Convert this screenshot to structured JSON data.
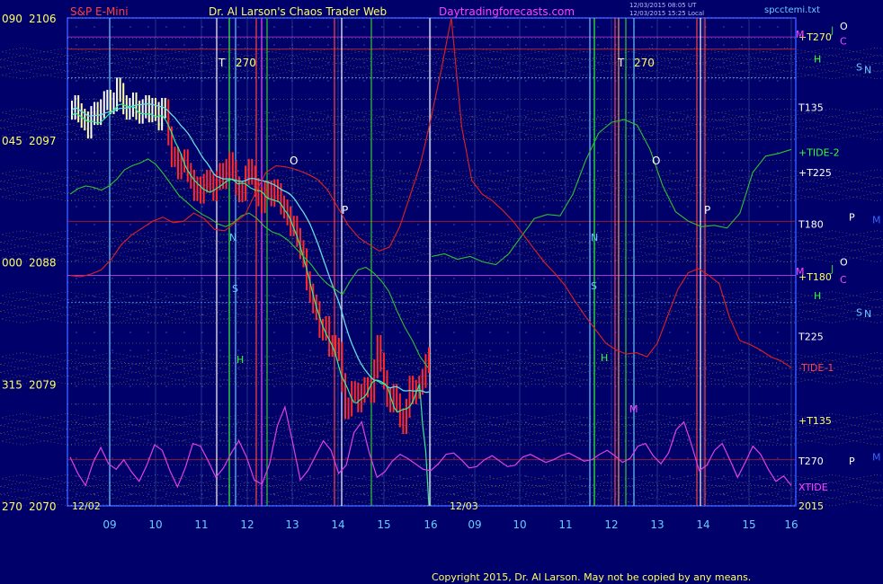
{
  "header": {
    "symbol": "S&P E-Mini",
    "title": "Dr. Al Larson's Chaos Trader Web",
    "site": "Daytradingforecasts.com",
    "stamp_line1": "12/03/2015 08:05 UT",
    "stamp_line2": "12/03/2015 15:25 Local",
    "file": "spcctemi.txt"
  },
  "footer": {
    "copyright": "Copyright 2015, Dr. Al Larson. May not be copied by any means."
  },
  "colors": {
    "background": "#00006a",
    "price_bar": "#ff2a2a",
    "price_bar_up": "#ffffff",
    "yellow_grid": "#ffff33",
    "tide_red": "#e02020",
    "tide_green": "#30c030",
    "xtide_magenta": "#e040e0",
    "avg_cyan": "#66dddd",
    "axis_blue": "#3355ff"
  },
  "chart_data": {
    "type": "line",
    "ylim": [
      2070,
      2106
    ],
    "y_ticks": [
      {
        "value": 2106,
        "left": "090",
        "label": "2106"
      },
      {
        "value": 2097,
        "left": "045",
        "label": "2097"
      },
      {
        "value": 2088,
        "left": "000",
        "label": "2088"
      },
      {
        "value": 2079,
        "left": "315",
        "label": "2079"
      },
      {
        "value": 2070,
        "left": "270",
        "label": "2070"
      }
    ],
    "day_labels": [
      "12/02",
      "12/03",
      "2015"
    ],
    "x_hours": {
      "day1": [
        "09",
        "10",
        "11",
        "12",
        "13",
        "14",
        "15",
        "16"
      ],
      "day2": [
        "09",
        "10",
        "11",
        "12",
        "13",
        "14",
        "15",
        "16"
      ]
    },
    "annotations_day1": [
      "T",
      "270",
      "O",
      "P",
      "N",
      "H",
      "S"
    ],
    "annotations_day2": [
      "T",
      "270",
      "O",
      "P",
      "N",
      "S",
      "H",
      "M"
    ],
    "right_labels": [
      {
        "text": "+T270",
        "value": 2104.6,
        "color": "#ffff66"
      },
      {
        "text": "T135",
        "value": 2099.4,
        "color": "#ffffff"
      },
      {
        "text": "+TIDE-2",
        "value": 2096.1,
        "color": "#33ff33"
      },
      {
        "text": "+T225",
        "value": 2094.6,
        "color": "#ffffff"
      },
      {
        "text": "T180",
        "value": 2090.8,
        "color": "#ffffff"
      },
      {
        "text": "+T180",
        "value": 2086.9,
        "color": "#ffff66"
      },
      {
        "text": "T225",
        "value": 2082.5,
        "color": "#ffffff"
      },
      {
        "text": "-TIDE-1",
        "value": 2080.2,
        "color": "#ff4444"
      },
      {
        "text": "+T135",
        "value": 2076.3,
        "color": "#ffff66"
      },
      {
        "text": "T270",
        "value": 2073.3,
        "color": "#ffffff"
      },
      {
        "text": "XTIDE",
        "value": 2071.4,
        "color": "#ff44ff"
      }
    ],
    "side_letters": [
      {
        "text": "O",
        "value": 2105.4,
        "color": "#ffffff"
      },
      {
        "text": "M",
        "value": 2104.8,
        "color": "#ff44ff"
      },
      {
        "text": "J",
        "value": 2105.1,
        "color": "#33cc33"
      },
      {
        "text": "C",
        "value": 2104.3,
        "color": "#ff44ff"
      },
      {
        "text": "H",
        "value": 2103.0,
        "color": "#33ff33"
      },
      {
        "text": "S",
        "value": 2102.4,
        "color": "#66ccff"
      },
      {
        "text": "N",
        "value": 2102.2,
        "color": "#66ccff"
      },
      {
        "text": "P",
        "value": 2091.3,
        "color": "#ffffff"
      },
      {
        "text": "M",
        "value": 2091.1,
        "color": "#3366ff"
      },
      {
        "text": "O",
        "value": 2088.0,
        "color": "#ffffff"
      },
      {
        "text": "M",
        "value": 2087.3,
        "color": "#ff44ff"
      },
      {
        "text": "J",
        "value": 2087.5,
        "color": "#33cc33"
      },
      {
        "text": "C",
        "value": 2086.7,
        "color": "#ff44ff"
      },
      {
        "text": "H",
        "value": 2085.5,
        "color": "#33ff33"
      },
      {
        "text": "S",
        "value": 2084.3,
        "color": "#66ccff"
      },
      {
        "text": "N",
        "value": 2084.2,
        "color": "#66ccff"
      },
      {
        "text": "P",
        "value": 2073.3,
        "color": "#ffffff"
      },
      {
        "text": "M",
        "value": 2073.6,
        "color": "#3366ff"
      }
    ],
    "price_series_day1": [
      2099.2,
      2099.6,
      2099.0,
      2098.6,
      2098.4,
      2097.8,
      2098.8,
      2099.1,
      2098.8,
      2099.3,
      2099.9,
      2100.0,
      2099.6,
      2099.8,
      2100.9,
      2100.5,
      2099.6,
      2099.2,
      2099.4,
      2099.8,
      2099.2,
      2098.9,
      2099.3,
      2099.6,
      2099.0,
      2099.4,
      2099.1,
      2098.4,
      2099.4,
      2099.3,
      2097.3,
      2095.7,
      2095.8,
      2094.8,
      2095.3,
      2095.6,
      2094.6,
      2094.1,
      2093.2,
      2093.6,
      2093.0,
      2093.8,
      2094.1,
      2093.8,
      2093.2,
      2094.0,
      2094.6,
      2094.1,
      2094.9,
      2095.4,
      2094.8,
      2093.6,
      2093.1,
      2093.2,
      2094.4,
      2094.9,
      2094.4,
      2093.5,
      2092.8,
      2092.3,
      2093.3,
      2093.3,
      2092.8,
      2093.4,
      2093.1,
      2092.2,
      2091.9,
      2091.4,
      2090.6,
      2090.7,
      2089.8,
      2088.9,
      2088.3,
      2086.6,
      2085.7,
      2084.9,
      2084.4,
      2083.1,
      2082.9,
      2083.3,
      2081.7,
      2081.9,
      2081.7,
      2081.4,
      2079.1,
      2077.1,
      2077.3,
      2078.5,
      2078.4,
      2077.6,
      2078.3,
      2078.8,
      2078.7,
      2078.3,
      2080.1,
      2081.9,
      2080.6,
      2079.3,
      2078.0,
      2077.6,
      2078.3,
      2077.6,
      2076.5,
      2076.0,
      2077.2,
      2078.9,
      2078.2,
      2078.6,
      2078.9,
      2079.4,
      2080.5,
      2081.0
    ],
    "xtide_series": [
      2073.6,
      2072.4,
      2071.5,
      2073.2,
      2074.3,
      2073.1,
      2072.7,
      2073.4,
      2072.5,
      2071.8,
      2073.0,
      2074.5,
      2074.1,
      2072.6,
      2071.4,
      2072.8,
      2074.6,
      2074.4,
      2073.3,
      2072.1,
      2072.8,
      2073.9,
      2074.8,
      2073.6,
      2071.9,
      2071.6,
      2073.1,
      2075.9,
      2077.3,
      2074.7,
      2071.9,
      2072.6,
      2073.7,
      2074.8,
      2074.1,
      2072.4,
      2073.0,
      2075.4,
      2076.2,
      2073.9,
      2072.1,
      2072.5,
      2073.3,
      2073.8,
      2073.5,
      2073.1,
      2072.7,
      2072.6,
      2073.1,
      2073.8,
      2073.9,
      2073.4,
      2072.8,
      2072.9,
      2073.4,
      2073.7,
      2073.3,
      2072.9,
      2073.0,
      2073.6,
      2073.8,
      2073.5,
      2073.2,
      2073.4,
      2073.7,
      2073.9,
      2073.6,
      2073.3,
      2073.4,
      2073.8,
      2074.1,
      2073.7,
      2073.2,
      2073.5,
      2074.4,
      2074.6,
      2073.7,
      2073.1,
      2073.9,
      2075.6,
      2076.2,
      2074.5,
      2072.6,
      2073.0,
      2074.1,
      2074.6,
      2073.4,
      2072.1,
      2073.2,
      2074.4,
      2073.8,
      2072.7,
      2071.8,
      2072.2,
      2071.5
    ],
    "tide_red_series": [
      2087.0,
      2086.9,
      2087.1,
      2087.4,
      2088.2,
      2089.3,
      2090.0,
      2090.5,
      2091.0,
      2091.3,
      2090.9,
      2091.0,
      2091.6,
      2091.2,
      2090.4,
      2090.3,
      2090.9,
      2091.5,
      2093.1,
      2094.6,
      2095.1,
      2095.0,
      2094.8,
      2094.5,
      2094.1,
      2093.3,
      2092.0,
      2090.7,
      2089.8,
      2089.3,
      2088.8,
      2089.1,
      2090.6,
      2092.9,
      2095.2,
      2098.5,
      2102.1,
      2106.0,
      2098.0,
      2094.0,
      2093.0,
      2092.5,
      2091.8,
      2091.0,
      2090.0,
      2089.0,
      2088.0,
      2087.2,
      2086.3,
      2085.1,
      2084.0,
      2083.0,
      2082.0,
      2081.5,
      2081.2,
      2081.3,
      2081.0,
      2082.0,
      2084.0,
      2086.0,
      2087.2,
      2087.5,
      2087.0,
      2086.4,
      2083.9,
      2082.2,
      2081.9,
      2081.5,
      2081.0,
      2080.7,
      2080.2
    ]
  }
}
